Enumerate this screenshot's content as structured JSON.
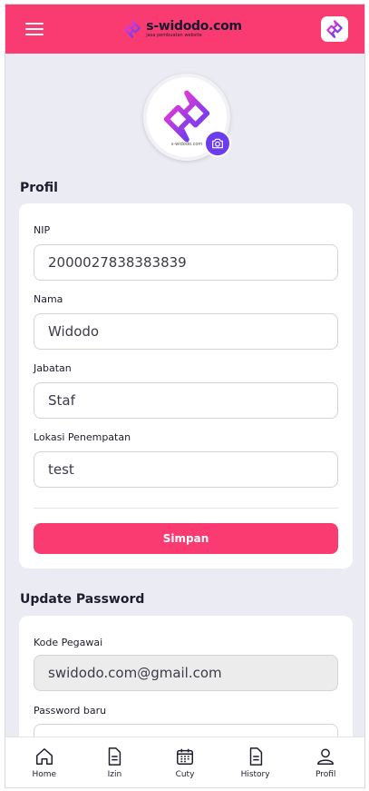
{
  "header": {
    "brand_name": "s-widodo.com",
    "brand_tagline": "jasa pembuatan website",
    "accent": "#fa3b72"
  },
  "avatar": {
    "caption": "s-widodo.com",
    "camera_icon": "camera-icon"
  },
  "profile": {
    "title": "Profil",
    "fields": [
      {
        "label": "NIP",
        "value": "2000027838383839"
      },
      {
        "label": "Nama",
        "value": "Widodo"
      },
      {
        "label": "Jabatan",
        "value": "Staf"
      },
      {
        "label": "Lokasi Penempatan",
        "value": "test"
      }
    ],
    "save_label": "Simpan"
  },
  "password": {
    "title": "Update Password",
    "fields": [
      {
        "label": "Kode Pegawai",
        "value": "swidodo.com@gmail.com"
      },
      {
        "label": "Password baru",
        "value": ""
      }
    ]
  },
  "nav": [
    {
      "label": "Home",
      "icon": "home-icon"
    },
    {
      "label": "Izin",
      "icon": "document-icon"
    },
    {
      "label": "Cuty",
      "icon": "calendar-icon"
    },
    {
      "label": "History",
      "icon": "history-icon"
    },
    {
      "label": "Profil",
      "icon": "user-icon"
    }
  ]
}
